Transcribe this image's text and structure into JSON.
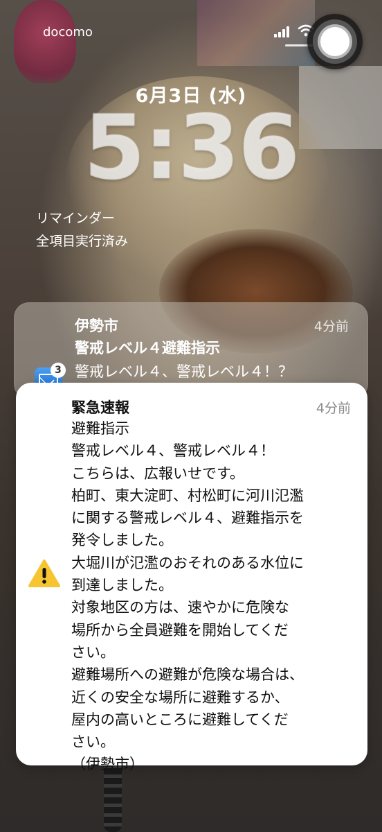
{
  "status_bar": {
    "carrier": "docomo"
  },
  "lock": {
    "date": "6月3日 (水)",
    "time": "5:36",
    "widget": {
      "title": "リマインダー",
      "subtitle": "全項目実行済み"
    }
  },
  "notification_back": {
    "app": "伊勢市",
    "time": "4分前",
    "subject": "警戒レベル４避難指示",
    "body": "警戒レベル４、警戒レベル４！？",
    "badge": "3",
    "icon": "mail-icon"
  },
  "notification_front": {
    "title": "緊急速報",
    "time": "4分前",
    "icon": "warning-icon",
    "lines": [
      "避難指示",
      "警戒レベル４、警戒レベル４！",
      "こちらは、広報いせです。",
      "柏町、東大淀町、村松町に河川氾濫",
      "に関する警戒レベル４、避難指示を",
      "発令しました。",
      "大堀川が氾濫のおそれのある水位に",
      "到達しました。",
      "対象地区の方は、速やかに危険な",
      "場所から全員避難を開始してくだ",
      "さい。",
      "避難場所への避難が危険な場合は、",
      "近くの安全な場所に避難するか、",
      "屋内の高いところに避難してくだ",
      "さい。",
      "（伊勢市）"
    ]
  },
  "colors": {
    "warning": "#f7c531",
    "mail": "#2f86e6"
  }
}
